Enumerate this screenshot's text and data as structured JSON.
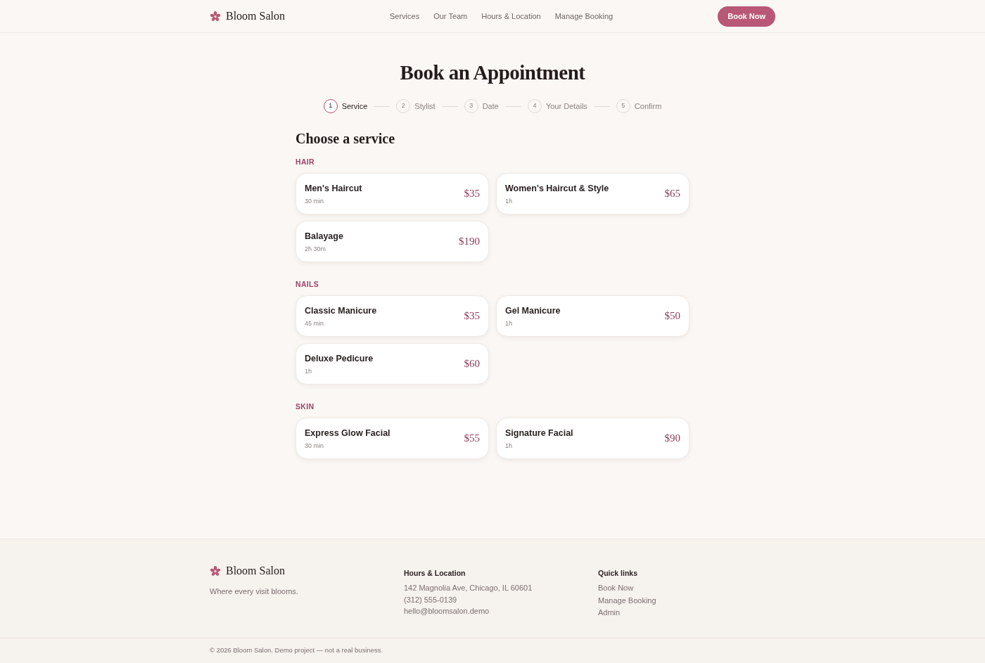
{
  "header": {
    "brand": "Bloom Salon",
    "nav": [
      "Services",
      "Our Team",
      "Hours & Location",
      "Manage Booking"
    ],
    "cta": "Book Now"
  },
  "page_title": "Book an Appointment",
  "steps": [
    {
      "number": "1",
      "label": "Service",
      "selected": true
    },
    {
      "number": "2",
      "label": "Stylist",
      "selected": false
    },
    {
      "number": "3",
      "label": "Date",
      "selected": false
    },
    {
      "number": "4",
      "label": "Your Details",
      "selected": false
    },
    {
      "number": "5",
      "label": "Confirm",
      "selected": false
    }
  ],
  "section_title": "Choose a service",
  "categories": [
    {
      "name": "HAIR",
      "services": [
        {
          "name": "Men's Haircut",
          "duration": "30 min",
          "price": "$35"
        },
        {
          "name": "Women's Haircut & Style",
          "duration": "1h",
          "price": "$65"
        },
        {
          "name": "Balayage",
          "duration": "2h 30m",
          "price": "$190"
        }
      ]
    },
    {
      "name": "NAILS",
      "services": [
        {
          "name": "Classic Manicure",
          "duration": "45 min",
          "price": "$35"
        },
        {
          "name": "Gel Manicure",
          "duration": "1h",
          "price": "$50"
        },
        {
          "name": "Deluxe Pedicure",
          "duration": "1h",
          "price": "$60"
        }
      ]
    },
    {
      "name": "SKIN",
      "services": [
        {
          "name": "Express Glow Facial",
          "duration": "30 min",
          "price": "$55"
        },
        {
          "name": "Signature Facial",
          "duration": "1h",
          "price": "$90"
        }
      ]
    }
  ],
  "footer": {
    "brand": "Bloom Salon",
    "tagline": "Where every visit blooms.",
    "contact": {
      "title": "Hours & Location",
      "lines": [
        "142 Magnolia Ave, Chicago, IL 60601",
        "(312) 555-0139",
        "hello@bloomsalon.demo"
      ]
    },
    "quick_links": {
      "title": "Quick links",
      "links": [
        "Book Now",
        "Manage Booking",
        "Admin"
      ]
    },
    "copyright": "© 2026 Bloom Salon. Demo project — not a real business."
  }
}
